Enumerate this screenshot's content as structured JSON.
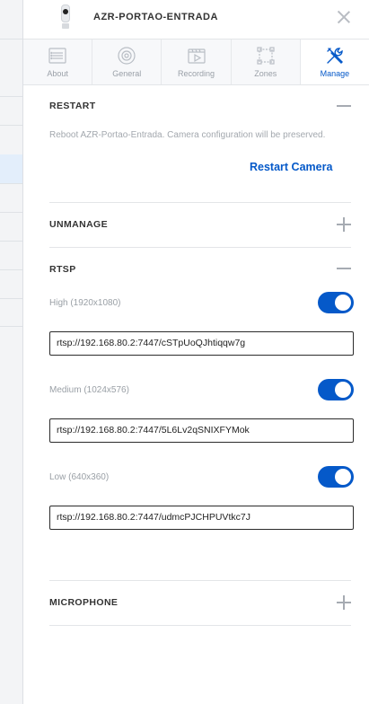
{
  "header": {
    "title": "AZR-PORTAO-ENTRADA"
  },
  "tabs": [
    {
      "label": "About",
      "icon": "list-icon"
    },
    {
      "label": "General",
      "icon": "camera-lens-icon"
    },
    {
      "label": "Recording",
      "icon": "film-play-icon"
    },
    {
      "label": "Zones",
      "icon": "zones-icon"
    },
    {
      "label": "Manage",
      "icon": "tools-icon",
      "active": true
    }
  ],
  "restart": {
    "heading": "RESTART",
    "description": "Reboot AZR-Portao-Entrada. Camera configuration will be preserved.",
    "button_label": "Restart Camera"
  },
  "unmanage": {
    "heading": "UNMANAGE"
  },
  "rtsp": {
    "heading": "RTSP",
    "streams": [
      {
        "label": "High (1920x1080)",
        "enabled": true,
        "url": "rtsp://192.168.80.2:7447/cSTpUoQJhtiqqw7g"
      },
      {
        "label": "Medium (1024x576)",
        "enabled": true,
        "url": "rtsp://192.168.80.2:7447/5L6Lv2qSNIXFYMok"
      },
      {
        "label": "Low (640x360)",
        "enabled": true,
        "url": "rtsp://192.168.80.2:7447/udmcPJCHPUVtkc7J"
      }
    ]
  },
  "microphone": {
    "heading": "MICROPHONE"
  },
  "colors": {
    "accent": "#0559c9",
    "muted_text": "#a3a8ae",
    "divider": "#e3e5e8"
  }
}
